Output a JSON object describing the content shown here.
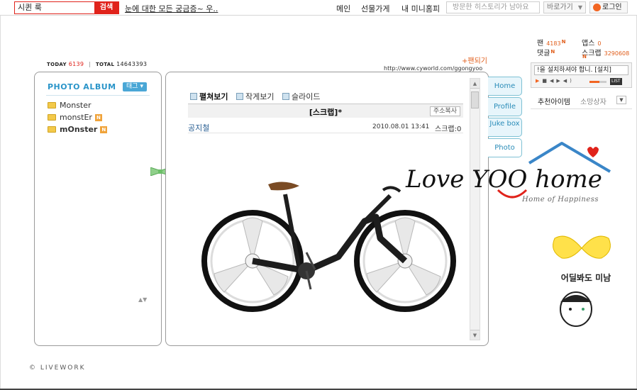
{
  "topbar": {
    "search_value": "시퀸 룩",
    "search_button": "검색",
    "promo_link": "눈에 대한 모든 궁금증~ 우..",
    "nav": [
      "메인",
      "선물가게",
      "내 미니홈피"
    ],
    "history_placeholder": "방문한 히스토리가 남아요",
    "goto_label": "바로가기",
    "login_label": "로그인"
  },
  "counter": {
    "today_label": "TODAY",
    "today_value": "6139",
    "total_label": "TOTAL",
    "total_value": "14643393"
  },
  "header": {
    "fan_link": "+팬되기",
    "url": "http://www.cyworld.com/ggongyoo"
  },
  "album": {
    "title": "PHOTO ALBUM",
    "tag_button": "태그",
    "folders": [
      {
        "name": "Monster",
        "new_badge": ""
      },
      {
        "name": "monstEr",
        "new_badge": "N"
      },
      {
        "name": "mOnster",
        "new_badge": "N"
      }
    ]
  },
  "post": {
    "view_options": [
      "펼쳐보기",
      "작게보기",
      "슬라이드"
    ],
    "board_title": "[스크랩]*",
    "copy_address": "주소복사",
    "author": "공지철",
    "date": "2010.08.01 13:41",
    "scrap_count": "스크랩:0"
  },
  "side_tabs": [
    "Home",
    "Profile",
    "Juke box",
    "Photo"
  ],
  "stats": {
    "fan_label": "팬",
    "fan_value": "4183",
    "fan_new": "N",
    "apps_label": "앱스",
    "apps_value": "0",
    "comment_label": "댓글",
    "comment_new": "N",
    "scrap_label": "스크랩",
    "scrap_value": "3290608",
    "scrap_new": "N"
  },
  "player": {
    "title": "!을 설치하셔야 합니. [설치]",
    "list_label": "LIST"
  },
  "recommend": {
    "tab_active": "추천아이템",
    "tab_inactive": "소망상자"
  },
  "artwork": {
    "logo_text": "Love YOO home",
    "logo_sub": "Home of Happiness",
    "caption": "어딜봐도 미남"
  },
  "footer": {
    "brand": "© LIVEWORK"
  }
}
